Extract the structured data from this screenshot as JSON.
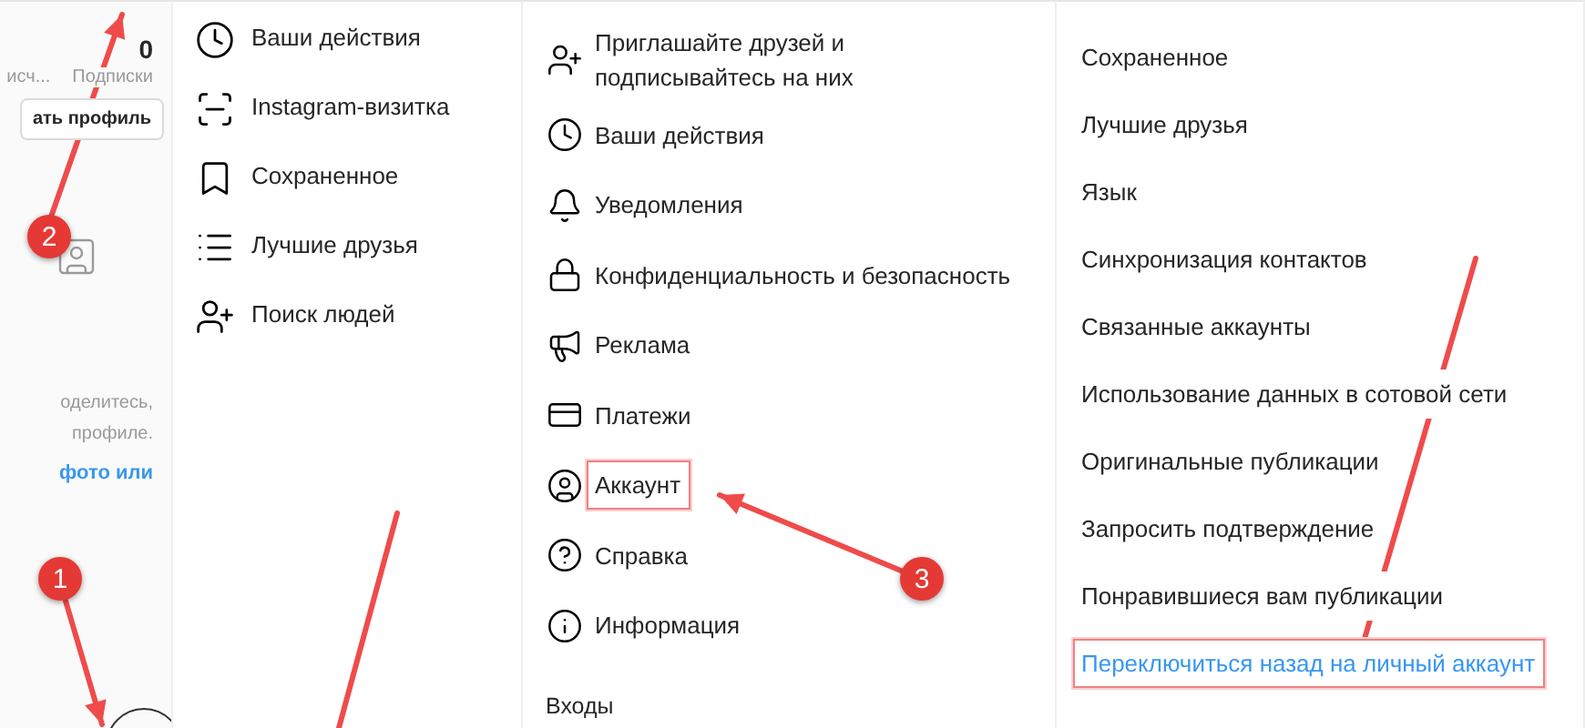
{
  "profile_panel": {
    "stats": [
      {
        "label": "исч..."
      },
      {
        "value": "0",
        "label": "Подписки"
      }
    ],
    "edit_button": "ать профиль",
    "empty_text": [
      "оделитесь,",
      "профиле."
    ],
    "link": "фото или"
  },
  "menu_panel": {
    "items": [
      {
        "label": "Ваши действия"
      },
      {
        "label": "Instagram-визитка"
      },
      {
        "label": "Сохраненное"
      },
      {
        "label": "Лучшие друзья"
      },
      {
        "label": "Поиск людей"
      }
    ]
  },
  "settings_panel": {
    "items": [
      {
        "label": "Приглашайте друзей и подписывайтесь на них",
        "kind": "item",
        "highlighted": false
      },
      {
        "label": "Ваши действия",
        "kind": "item",
        "highlighted": false
      },
      {
        "label": "Уведомления",
        "kind": "item",
        "highlighted": false
      },
      {
        "label": "Конфиденциальность и безопасность",
        "kind": "item",
        "highlighted": false
      },
      {
        "label": "Реклама",
        "kind": "item",
        "highlighted": false
      },
      {
        "label": "Платежи",
        "kind": "item",
        "highlighted": false
      },
      {
        "label": "Аккаунт",
        "kind": "item",
        "highlighted": true
      },
      {
        "label": "Справка",
        "kind": "item",
        "highlighted": false
      },
      {
        "label": "Информация",
        "kind": "item",
        "highlighted": false
      },
      {
        "label": "Входы",
        "kind": "heading",
        "highlighted": false
      }
    ]
  },
  "account_panel": {
    "items": [
      {
        "label": "Сохраненное",
        "kind": "item",
        "highlighted": false
      },
      {
        "label": "Лучшие друзья",
        "kind": "item",
        "highlighted": false
      },
      {
        "label": "Язык",
        "kind": "item",
        "highlighted": false
      },
      {
        "label": "Синхронизация контактов",
        "kind": "item",
        "highlighted": false
      },
      {
        "label": "Связанные аккаунты",
        "kind": "item",
        "highlighted": false
      },
      {
        "label": "Использование данных в сотовой сети",
        "kind": "item",
        "highlighted": false
      },
      {
        "label": "Оригинальные публикации",
        "kind": "item",
        "highlighted": false
      },
      {
        "label": "Запросить подтверждение",
        "kind": "item",
        "highlighted": false
      },
      {
        "label": "Понравившиеся вам публикации",
        "kind": "item",
        "highlighted": false
      },
      {
        "label": "Переключиться назад на личный аккаунт",
        "kind": "link",
        "highlighted": true
      }
    ]
  },
  "annotations": [
    {
      "number": "1"
    },
    {
      "number": "2"
    },
    {
      "number": "3"
    }
  ]
}
